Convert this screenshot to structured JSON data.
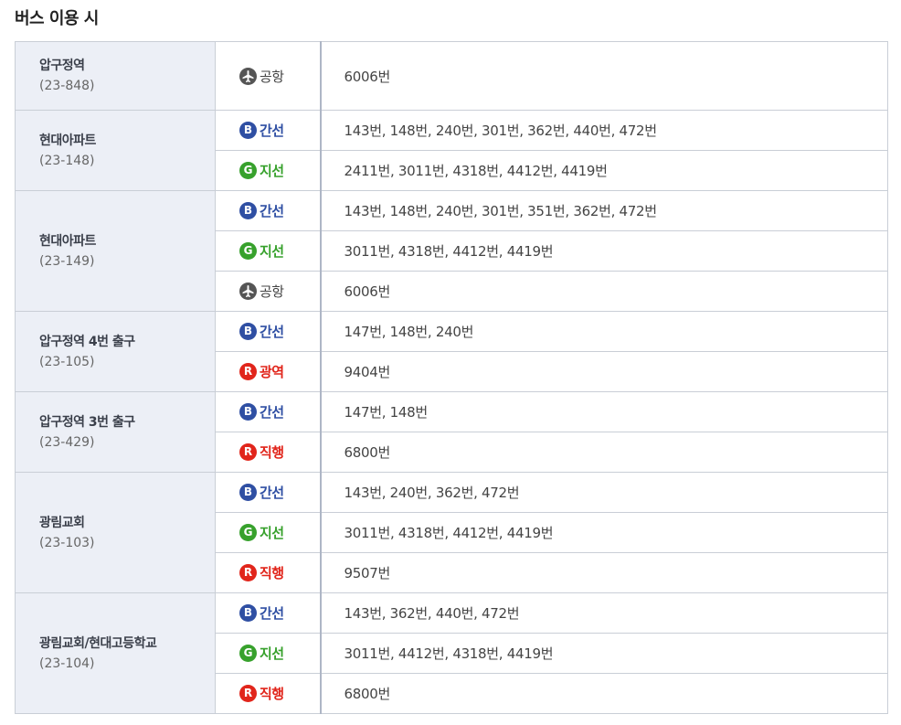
{
  "title": "버스 이용 시",
  "colors": {
    "blue": "#2f4fa3",
    "green": "#37a12c",
    "red": "#e1251b",
    "gray": "#555555"
  },
  "types": {
    "airport": {
      "label": "공항",
      "icon": "airplane-icon",
      "badge": "✈",
      "color": "#555555"
    },
    "trunk": {
      "label": "간선",
      "icon": "blue-bus-icon",
      "badge": "B",
      "color": "#2f4fa3"
    },
    "branch": {
      "label": "지선",
      "icon": "green-bus-icon",
      "badge": "G",
      "color": "#37a12c"
    },
    "wide": {
      "label": "광역",
      "icon": "red-bus-icon",
      "badge": "R",
      "color": "#e1251b"
    },
    "express": {
      "label": "직행",
      "icon": "red-bus-icon",
      "badge": "R",
      "color": "#e1251b"
    }
  },
  "stops": [
    {
      "name": "압구정역",
      "id": "(23-848)",
      "rows": [
        {
          "type": "airport",
          "routes": "6006번"
        }
      ]
    },
    {
      "name": "현대아파트",
      "id": "(23-148)",
      "rows": [
        {
          "type": "trunk",
          "routes": "143번, 148번, 240번, 301번, 362번, 440번, 472번"
        },
        {
          "type": "branch",
          "routes": "2411번, 3011번, 4318번, 4412번, 4419번"
        }
      ]
    },
    {
      "name": "현대아파트",
      "id": "(23-149)",
      "rows": [
        {
          "type": "trunk",
          "routes": "143번, 148번, 240번, 301번, 351번, 362번, 472번"
        },
        {
          "type": "branch",
          "routes": "3011번, 4318번, 4412번, 4419번"
        },
        {
          "type": "airport",
          "routes": "6006번"
        }
      ]
    },
    {
      "name": "압구정역 4번 출구",
      "id": "(23-105)",
      "rows": [
        {
          "type": "trunk",
          "routes": "147번, 148번, 240번"
        },
        {
          "type": "wide",
          "routes": "9404번"
        }
      ]
    },
    {
      "name": "압구정역 3번 출구",
      "id": "(23-429)",
      "rows": [
        {
          "type": "trunk",
          "routes": "147번, 148번"
        },
        {
          "type": "express",
          "routes": "6800번"
        }
      ]
    },
    {
      "name": "광림교회",
      "id": "(23-103)",
      "rows": [
        {
          "type": "trunk",
          "routes": "143번, 240번, 362번, 472번"
        },
        {
          "type": "branch",
          "routes": "3011번, 4318번, 4412번, 4419번"
        },
        {
          "type": "express",
          "routes": "9507번"
        }
      ]
    },
    {
      "name": "광림교회/현대고등학교",
      "id": "(23-104)",
      "rows": [
        {
          "type": "trunk",
          "routes": "143번, 362번, 440번, 472번"
        },
        {
          "type": "branch",
          "routes": "3011번, 4412번, 4318번, 4419번"
        },
        {
          "type": "express",
          "routes": "6800번"
        }
      ]
    }
  ]
}
